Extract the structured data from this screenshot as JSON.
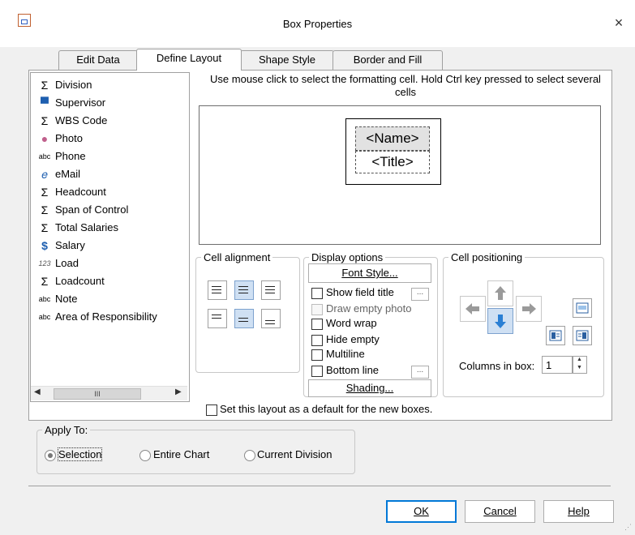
{
  "window": {
    "title": "Box Properties",
    "close_label": "×"
  },
  "tabs": [
    {
      "label": "Edit Data"
    },
    {
      "label": "Define Layout"
    },
    {
      "label": "Shape Style"
    },
    {
      "label": "Border and Fill"
    }
  ],
  "fields": [
    {
      "icon": "Σ",
      "label": "Division"
    },
    {
      "icon": "▀",
      "label": "Supervisor"
    },
    {
      "icon": "Σ",
      "label": "WBS Code"
    },
    {
      "icon": "●",
      "label": "Photo"
    },
    {
      "icon": "abc",
      "label": "Phone"
    },
    {
      "icon": "𝑒",
      "label": "eMail"
    },
    {
      "icon": "Σ",
      "label": "Headcount"
    },
    {
      "icon": "Σ",
      "label": "Span of Control"
    },
    {
      "icon": "Σ",
      "label": "Total Salaries"
    },
    {
      "icon": "$",
      "label": "Salary"
    },
    {
      "icon": "123",
      "label": "Load"
    },
    {
      "icon": "Σ",
      "label": "Loadcount"
    },
    {
      "icon": "abc",
      "label": "Note"
    },
    {
      "icon": "abc",
      "label": "Area of Responsibility"
    }
  ],
  "scrollbar": {
    "thumb_label": "III"
  },
  "instructions": "Use mouse click to select the formatting cell. Hold Ctrl key pressed to select several cells",
  "preview": {
    "cell1": "<Name>",
    "cell2": "<Title>"
  },
  "cell_alignment": {
    "legend": "Cell alignment"
  },
  "display_options": {
    "legend": "Display options",
    "font_style_button": "Font Style...",
    "show_field_title": "Show field title",
    "draw_empty_photo": "Draw empty photo",
    "word_wrap": "Word wrap",
    "hide_empty": "Hide empty",
    "multiline": "Multiline",
    "bottom_line": "Bottom line",
    "ellipsis": "...",
    "shading_button": "Shading..."
  },
  "cell_positioning": {
    "legend": "Cell positioning",
    "columns_label": "Columns in box:",
    "columns_value": "1"
  },
  "default_layout_label": "Set this layout as a default for the new boxes.",
  "apply_to": {
    "legend": "Apply To:",
    "options": [
      "Selection",
      "Entire Chart",
      "Current Division"
    ],
    "selected": "Selection"
  },
  "buttons": {
    "ok": "OK",
    "cancel": "Cancel",
    "help": "Help"
  },
  "colors": {
    "accent": "#0078d7",
    "selected_bg": "#cfe0f3",
    "arrow_blue": "#2a7fd4",
    "photo_icon": "#c0608c"
  }
}
